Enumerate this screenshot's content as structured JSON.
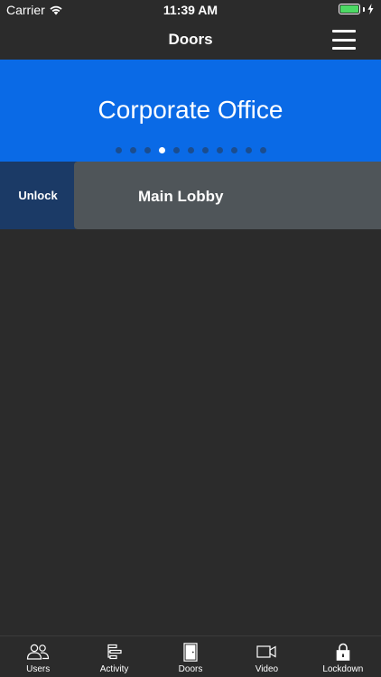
{
  "status_bar": {
    "carrier": "Carrier",
    "time": "11:39 AM",
    "battery_level": 1.0,
    "battery_color": "#4cd964"
  },
  "nav": {
    "title": "Doors",
    "menu_icon": "hamburger-menu-icon"
  },
  "banner": {
    "title": "Corporate Office",
    "background": "#0a6ae6",
    "page_count": 11,
    "active_page": 4
  },
  "door": {
    "unlock_label": "Unlock",
    "name": "Main Lobby"
  },
  "tabs": [
    {
      "label": "Users",
      "icon": "users-icon"
    },
    {
      "label": "Activity",
      "icon": "activity-icon"
    },
    {
      "label": "Doors",
      "icon": "door-icon"
    },
    {
      "label": "Video",
      "icon": "video-icon"
    },
    {
      "label": "Lockdown",
      "icon": "lock-icon"
    }
  ]
}
